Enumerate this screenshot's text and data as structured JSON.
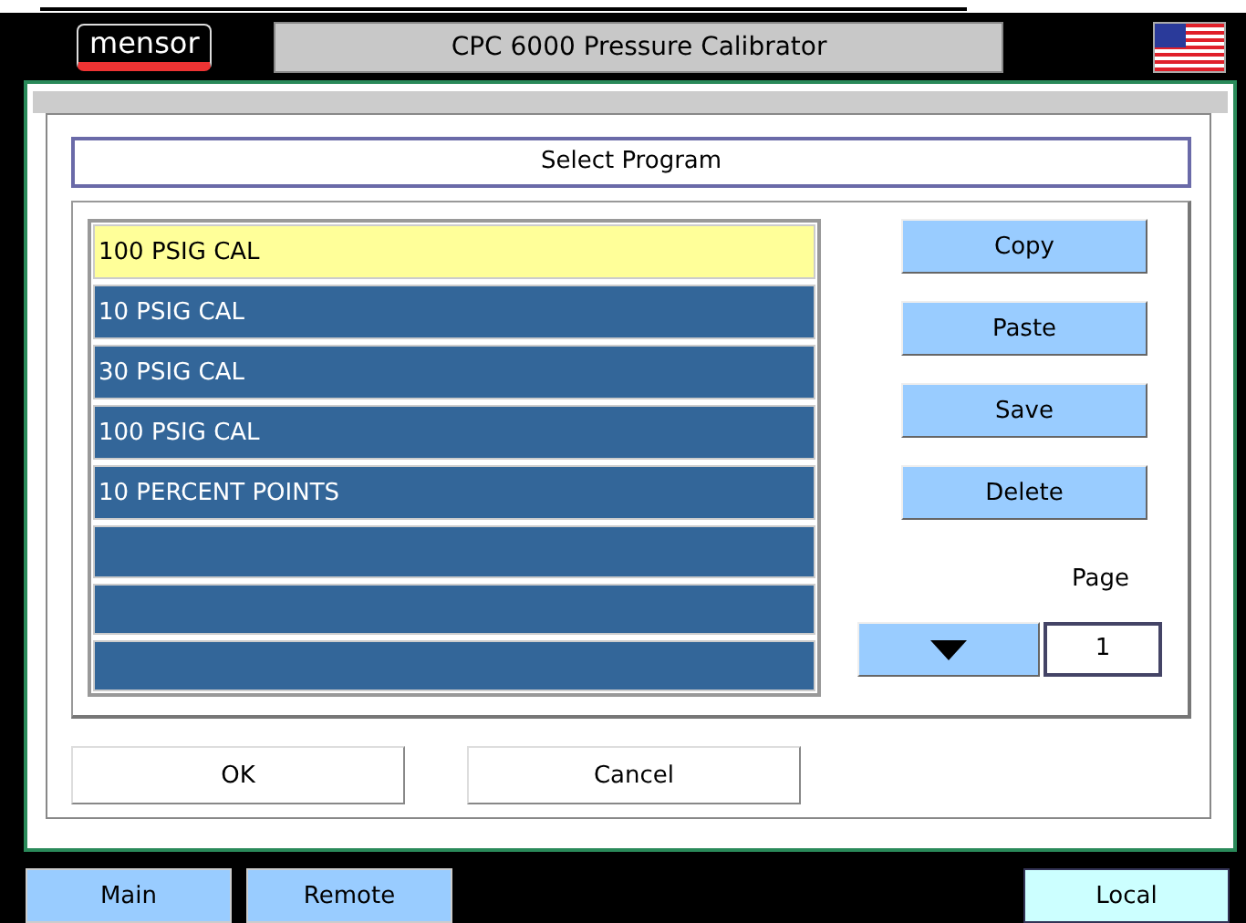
{
  "header": {
    "logo": "mensor",
    "title": "CPC 6000 Pressure Calibrator"
  },
  "dialog": {
    "title": "Select Program",
    "programs": [
      {
        "text": "100 PSIG CAL",
        "selected": true
      },
      {
        "text": "10 PSIG CAL",
        "selected": false
      },
      {
        "text": "30 PSIG CAL",
        "selected": false
      },
      {
        "text": "100 PSIG CAL",
        "selected": false
      },
      {
        "text": "10 PERCENT POINTS",
        "selected": false
      },
      {
        "selected": false
      },
      {
        "selected": false
      },
      {
        "selected": false
      }
    ],
    "actions": [
      "Copy",
      "Paste",
      "Save",
      "Delete"
    ],
    "page_label": "Page",
    "page_value": "1",
    "buttons": [
      "OK",
      "Cancel"
    ]
  },
  "bottom_tabs": [
    {
      "label": "Main",
      "selected": false
    },
    {
      "label": "Remote",
      "selected": false
    },
    {
      "label": "Local",
      "selected": true
    }
  ]
}
